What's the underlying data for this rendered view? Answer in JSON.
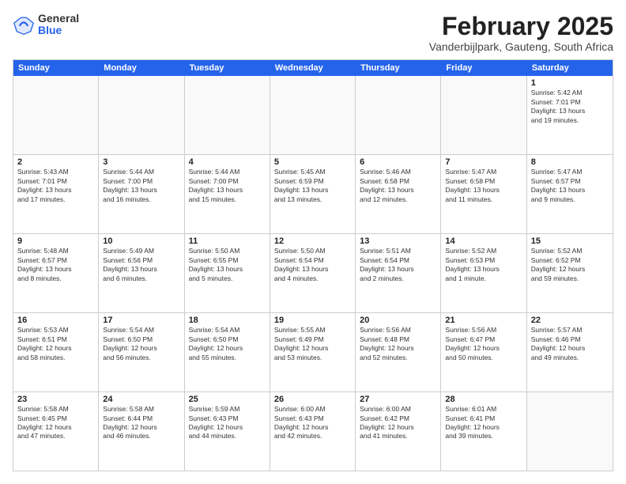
{
  "logo": {
    "general": "General",
    "blue": "Blue"
  },
  "title": "February 2025",
  "subtitle": "Vanderbijlpark, Gauteng, South Africa",
  "header_days": [
    "Sunday",
    "Monday",
    "Tuesday",
    "Wednesday",
    "Thursday",
    "Friday",
    "Saturday"
  ],
  "weeks": [
    [
      {
        "day": "",
        "info": ""
      },
      {
        "day": "",
        "info": ""
      },
      {
        "day": "",
        "info": ""
      },
      {
        "day": "",
        "info": ""
      },
      {
        "day": "",
        "info": ""
      },
      {
        "day": "",
        "info": ""
      },
      {
        "day": "1",
        "info": "Sunrise: 5:42 AM\nSunset: 7:01 PM\nDaylight: 13 hours\nand 19 minutes."
      }
    ],
    [
      {
        "day": "2",
        "info": "Sunrise: 5:43 AM\nSunset: 7:01 PM\nDaylight: 13 hours\nand 17 minutes."
      },
      {
        "day": "3",
        "info": "Sunrise: 5:44 AM\nSunset: 7:00 PM\nDaylight: 13 hours\nand 16 minutes."
      },
      {
        "day": "4",
        "info": "Sunrise: 5:44 AM\nSunset: 7:00 PM\nDaylight: 13 hours\nand 15 minutes."
      },
      {
        "day": "5",
        "info": "Sunrise: 5:45 AM\nSunset: 6:59 PM\nDaylight: 13 hours\nand 13 minutes."
      },
      {
        "day": "6",
        "info": "Sunrise: 5:46 AM\nSunset: 6:58 PM\nDaylight: 13 hours\nand 12 minutes."
      },
      {
        "day": "7",
        "info": "Sunrise: 5:47 AM\nSunset: 6:58 PM\nDaylight: 13 hours\nand 11 minutes."
      },
      {
        "day": "8",
        "info": "Sunrise: 5:47 AM\nSunset: 6:57 PM\nDaylight: 13 hours\nand 9 minutes."
      }
    ],
    [
      {
        "day": "9",
        "info": "Sunrise: 5:48 AM\nSunset: 6:57 PM\nDaylight: 13 hours\nand 8 minutes."
      },
      {
        "day": "10",
        "info": "Sunrise: 5:49 AM\nSunset: 6:56 PM\nDaylight: 13 hours\nand 6 minutes."
      },
      {
        "day": "11",
        "info": "Sunrise: 5:50 AM\nSunset: 6:55 PM\nDaylight: 13 hours\nand 5 minutes."
      },
      {
        "day": "12",
        "info": "Sunrise: 5:50 AM\nSunset: 6:54 PM\nDaylight: 13 hours\nand 4 minutes."
      },
      {
        "day": "13",
        "info": "Sunrise: 5:51 AM\nSunset: 6:54 PM\nDaylight: 13 hours\nand 2 minutes."
      },
      {
        "day": "14",
        "info": "Sunrise: 5:52 AM\nSunset: 6:53 PM\nDaylight: 13 hours\nand 1 minute."
      },
      {
        "day": "15",
        "info": "Sunrise: 5:52 AM\nSunset: 6:52 PM\nDaylight: 12 hours\nand 59 minutes."
      }
    ],
    [
      {
        "day": "16",
        "info": "Sunrise: 5:53 AM\nSunset: 6:51 PM\nDaylight: 12 hours\nand 58 minutes."
      },
      {
        "day": "17",
        "info": "Sunrise: 5:54 AM\nSunset: 6:50 PM\nDaylight: 12 hours\nand 56 minutes."
      },
      {
        "day": "18",
        "info": "Sunrise: 5:54 AM\nSunset: 6:50 PM\nDaylight: 12 hours\nand 55 minutes."
      },
      {
        "day": "19",
        "info": "Sunrise: 5:55 AM\nSunset: 6:49 PM\nDaylight: 12 hours\nand 53 minutes."
      },
      {
        "day": "20",
        "info": "Sunrise: 5:56 AM\nSunset: 6:48 PM\nDaylight: 12 hours\nand 52 minutes."
      },
      {
        "day": "21",
        "info": "Sunrise: 5:56 AM\nSunset: 6:47 PM\nDaylight: 12 hours\nand 50 minutes."
      },
      {
        "day": "22",
        "info": "Sunrise: 5:57 AM\nSunset: 6:46 PM\nDaylight: 12 hours\nand 49 minutes."
      }
    ],
    [
      {
        "day": "23",
        "info": "Sunrise: 5:58 AM\nSunset: 6:45 PM\nDaylight: 12 hours\nand 47 minutes."
      },
      {
        "day": "24",
        "info": "Sunrise: 5:58 AM\nSunset: 6:44 PM\nDaylight: 12 hours\nand 46 minutes."
      },
      {
        "day": "25",
        "info": "Sunrise: 5:59 AM\nSunset: 6:43 PM\nDaylight: 12 hours\nand 44 minutes."
      },
      {
        "day": "26",
        "info": "Sunrise: 6:00 AM\nSunset: 6:43 PM\nDaylight: 12 hours\nand 42 minutes."
      },
      {
        "day": "27",
        "info": "Sunrise: 6:00 AM\nSunset: 6:42 PM\nDaylight: 12 hours\nand 41 minutes."
      },
      {
        "day": "28",
        "info": "Sunrise: 6:01 AM\nSunset: 6:41 PM\nDaylight: 12 hours\nand 39 minutes."
      },
      {
        "day": "",
        "info": ""
      }
    ]
  ]
}
